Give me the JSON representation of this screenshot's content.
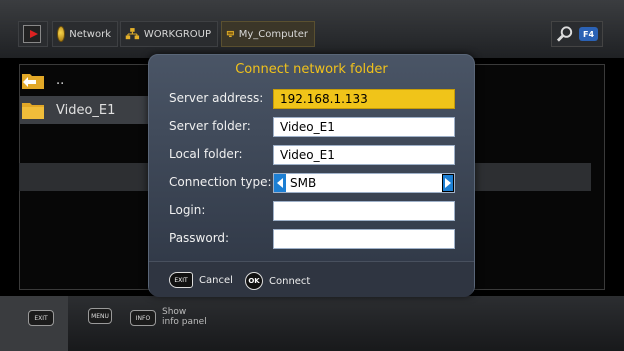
{
  "breadcrumb": {
    "items": [
      {
        "label": "",
        "icon": "video-film-icon"
      },
      {
        "label": "Network",
        "icon": "globe-icon"
      },
      {
        "label": "WORKGROUP",
        "icon": "network-icon"
      },
      {
        "label": "My_Computer",
        "icon": "computer-icon"
      }
    ]
  },
  "search": {
    "key_label": "F4",
    "icon": "search-icon"
  },
  "file_list": {
    "items": [
      {
        "label": "..",
        "icon": "folder-up-icon"
      },
      {
        "label": "Video_E1",
        "icon": "folder-icon"
      }
    ]
  },
  "dialog": {
    "title": "Connect network folder",
    "server_address_label": "Server address:",
    "server_address_value": "192.168.1.133",
    "server_folder_label": "Server folder:",
    "server_folder_value": "Video_E1",
    "local_folder_label": "Local folder:",
    "local_folder_value": "Video_E1",
    "connection_type_label": "Connection type:",
    "connection_type_value": "SMB",
    "login_label": "Login:",
    "login_value": "",
    "password_label": "Password:",
    "password_value": "",
    "cancel_key": "EXIT",
    "cancel_label": "Cancel",
    "connect_key": "OK",
    "connect_label": "Connect"
  },
  "bottom_bar": {
    "exit_key": "EXIT",
    "menu_key": "MENU",
    "info_key": "INFO",
    "info_label_line1": "Show",
    "info_label_line2": "info panel"
  },
  "colors": {
    "accent": "#f0c419",
    "title": "#f1c21b",
    "select_arrow": "#1d7fd3"
  }
}
